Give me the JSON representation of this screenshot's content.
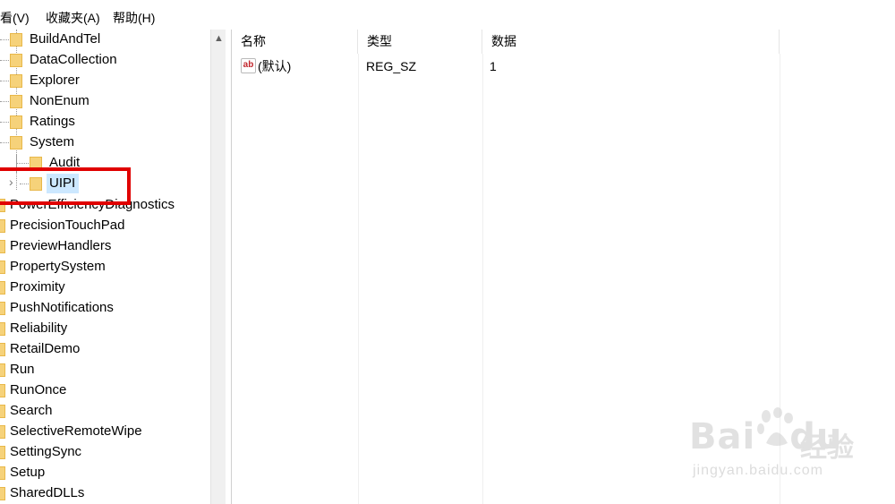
{
  "menu": [
    "查看(V)",
    "收藏夹(A)",
    "帮助(H)"
  ],
  "tree": {
    "nested_items": [
      "BuildAndTel",
      "DataCollection",
      "Explorer",
      "NonEnum",
      "Ratings",
      "System"
    ],
    "system_children": [
      "Audit",
      "UIPI"
    ],
    "selected": "UIPI",
    "items": [
      "PowerEfficiencyDiagnostics",
      "PrecisionTouchPad",
      "PreviewHandlers",
      "PropertySystem",
      "Proximity",
      "PushNotifications",
      "Reliability",
      "RetailDemo",
      "Run",
      "RunOnce",
      "Search",
      "SelectiveRemoteWipe",
      "SettingSync",
      "Setup",
      "SharedDLLs"
    ]
  },
  "list": {
    "headers": {
      "name": "名称",
      "type": "类型",
      "data": "数据"
    },
    "rows": [
      {
        "icon": "string-value-icon",
        "icon_text": "ab",
        "name": "(默认)",
        "type": "REG_SZ",
        "data": "1"
      }
    ]
  },
  "watermark": {
    "brand_prefix": "Bai",
    "brand_suffix": "du",
    "brand_cn": "经验",
    "url": "jingyan.baidu.com"
  },
  "colors": {
    "folder": "#f6d27a",
    "selection": "#cce8ff",
    "highlight": "#e00000"
  }
}
